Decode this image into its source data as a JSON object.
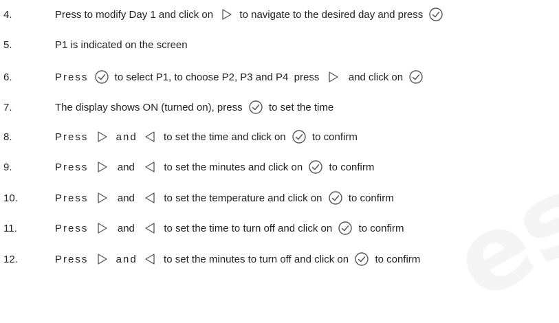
{
  "steps": [
    {
      "num": "4.",
      "parts": [
        {
          "t": "Press to modify Day 1 and click on "
        },
        {
          "icon": "next"
        },
        {
          "t": " to navigate to the desired day and press "
        },
        {
          "icon": "ok"
        }
      ]
    },
    {
      "num": "5.",
      "parts": [
        {
          "t": "P1 is indicated on the screen"
        }
      ]
    },
    {
      "num": "6.",
      "parts": [
        {
          "t": "Press",
          "sp": true
        },
        {
          "t": " "
        },
        {
          "icon": "ok"
        },
        {
          "t": " to select P1, to choose P2, P3 and P4  press "
        },
        {
          "icon": "next"
        },
        {
          "t": "  and click on "
        },
        {
          "icon": "ok"
        }
      ]
    },
    {
      "num": "7.",
      "parts": [
        {
          "t": "The display shows ON (turned on), press "
        },
        {
          "icon": "ok"
        },
        {
          "t": " to set the time"
        }
      ]
    },
    {
      "num": "8.",
      "parts": [
        {
          "t": "Press",
          "sp": true
        },
        {
          "t": " "
        },
        {
          "icon": "next"
        },
        {
          "t": " and",
          "sp": true
        },
        {
          "t": " "
        },
        {
          "icon": "prev"
        },
        {
          "t": " to set the time and click on "
        },
        {
          "icon": "ok"
        },
        {
          "t": " to confirm"
        }
      ]
    },
    {
      "num": "9.",
      "parts": [
        {
          "t": "Press",
          "sp": true
        },
        {
          "t": " "
        },
        {
          "icon": "next"
        },
        {
          "t": "  and  "
        },
        {
          "icon": "prev"
        },
        {
          "t": " to set the minutes and click on "
        },
        {
          "icon": "ok"
        },
        {
          "t": " to confirm"
        }
      ]
    },
    {
      "num": "10.",
      "parts": [
        {
          "t": "Press",
          "sp": true
        },
        {
          "t": " "
        },
        {
          "icon": "next"
        },
        {
          "t": "  and  "
        },
        {
          "icon": "prev"
        },
        {
          "t": " to set the temperature and click on "
        },
        {
          "icon": "ok"
        },
        {
          "t": " to confirm"
        }
      ]
    },
    {
      "num": "11.",
      "parts": [
        {
          "t": "Press",
          "sp": true
        },
        {
          "t": " "
        },
        {
          "icon": "next"
        },
        {
          "t": "  and  "
        },
        {
          "icon": "prev"
        },
        {
          "t": " to set the time to turn off and click on "
        },
        {
          "icon": "ok"
        },
        {
          "t": " to confirm"
        }
      ]
    },
    {
      "num": "12.",
      "parts": [
        {
          "t": "Press",
          "sp": true
        },
        {
          "t": " "
        },
        {
          "icon": "next"
        },
        {
          "t": " and",
          "sp": true
        },
        {
          "t": " "
        },
        {
          "icon": "prev"
        },
        {
          "t": " to set the minutes to turn off and click on "
        },
        {
          "icon": "ok"
        },
        {
          "t": " to confirm"
        }
      ]
    }
  ],
  "icons": {
    "next": "play-right-icon",
    "prev": "play-left-icon",
    "ok": "checkmark-circle-icon"
  },
  "colors": {
    "text": "#222222",
    "icon_stroke": "#555555"
  }
}
